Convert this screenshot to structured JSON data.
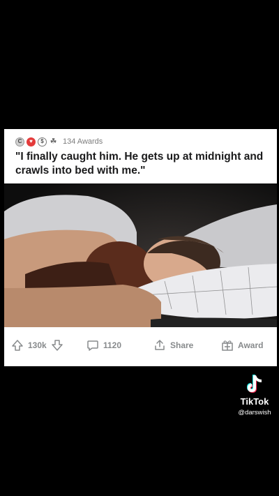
{
  "post": {
    "awards_count": "134 Awards",
    "title": "\"I finally caught him. He gets up at midnight and crawls into bed with me.\"",
    "award_icons": [
      "silver-award-icon",
      "wholesome-award-icon",
      "dollar-award-icon",
      "gold-award-icon"
    ]
  },
  "actions": {
    "upvotes": "130k",
    "comments": "1120",
    "share_label": "Share",
    "award_label": "Award"
  },
  "watermark": {
    "brand": "TikTok",
    "username": "@darswish"
  },
  "colors": {
    "background": "#000000",
    "card": "#ffffff",
    "text": "#1a1a1b",
    "muted": "#878a8c"
  }
}
